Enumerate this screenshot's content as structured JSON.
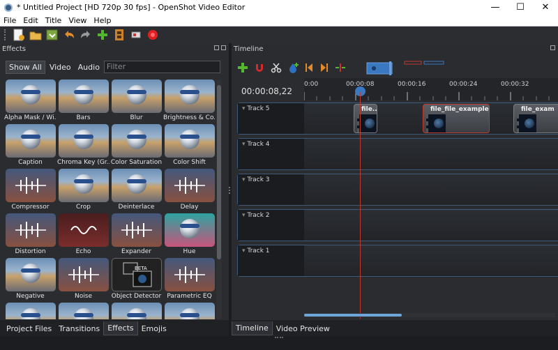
{
  "window": {
    "title": "* Untitled Project [HD 720p 30 fps] - OpenShot Video Editor",
    "controls": [
      "—",
      "☐",
      "✕"
    ]
  },
  "menu": [
    "File",
    "Edit",
    "Title",
    "View",
    "Help"
  ],
  "toolbar": [
    "new-project",
    "open-project",
    "save-project",
    "undo",
    "redo",
    "import-files",
    "choose-profile",
    "fullscreen",
    "export-video"
  ],
  "effects_panel": {
    "title": "Effects",
    "filters": [
      "Show All",
      "Video",
      "Audio"
    ],
    "filter_placeholder": "Filter",
    "items": [
      {
        "label": "Alpha Mask / Wi...",
        "style": "ball"
      },
      {
        "label": "Bars",
        "style": "ball"
      },
      {
        "label": "Blur",
        "style": "ball"
      },
      {
        "label": "Brightness & Co...",
        "style": "ball"
      },
      {
        "label": "Caption",
        "style": "ball"
      },
      {
        "label": "Chroma Key (Gr...",
        "style": "ball"
      },
      {
        "label": "Color Saturation",
        "style": "ball"
      },
      {
        "label": "Color Shift",
        "style": "ball"
      },
      {
        "label": "Compressor",
        "style": "audio"
      },
      {
        "label": "Crop",
        "style": "ball"
      },
      {
        "label": "Deinterlace",
        "style": "ball"
      },
      {
        "label": "Delay",
        "style": "audio"
      },
      {
        "label": "Distortion",
        "style": "audio"
      },
      {
        "label": "Echo",
        "style": "red"
      },
      {
        "label": "Expander",
        "style": "audio"
      },
      {
        "label": "Hue",
        "style": "teal"
      },
      {
        "label": "Negative",
        "style": "ball"
      },
      {
        "label": "Noise",
        "style": "audio"
      },
      {
        "label": "Object Detector",
        "style": "beta"
      },
      {
        "label": "Parametric EQ",
        "style": "audio"
      },
      {
        "label": "",
        "style": "ball"
      },
      {
        "label": "",
        "style": "ball"
      },
      {
        "label": "",
        "style": "ball"
      },
      {
        "label": "",
        "style": "ball"
      }
    ]
  },
  "left_tabs": [
    "Project Files",
    "Transitions",
    "Effects",
    "Emojis"
  ],
  "timeline_panel": {
    "title": "Timeline",
    "timecode": "00:00:08,22",
    "ruler_labels": [
      "0:00",
      "00:00:08",
      "00:00:16",
      "00:00:24",
      "00:00:32"
    ],
    "tracks": [
      {
        "name": "Track 5",
        "clips": [
          {
            "label": "file...",
            "selected": false
          },
          {
            "label": "file_file_example_l...",
            "selected": true
          },
          {
            "label": "file_exam",
            "selected": false
          }
        ]
      },
      {
        "name": "Track 4",
        "clips": []
      },
      {
        "name": "Track 3",
        "clips": []
      },
      {
        "name": "Track 2",
        "clips": []
      },
      {
        "name": "Track 1",
        "clips": []
      }
    ]
  },
  "right_tabs": [
    "Timeline",
    "Video Preview"
  ],
  "colors": {
    "accent_blue": "#3b78c2",
    "playhead_red": "#c0392b",
    "add_green": "#53b82c",
    "record_red": "#e02020",
    "orange": "#e58a2a"
  }
}
